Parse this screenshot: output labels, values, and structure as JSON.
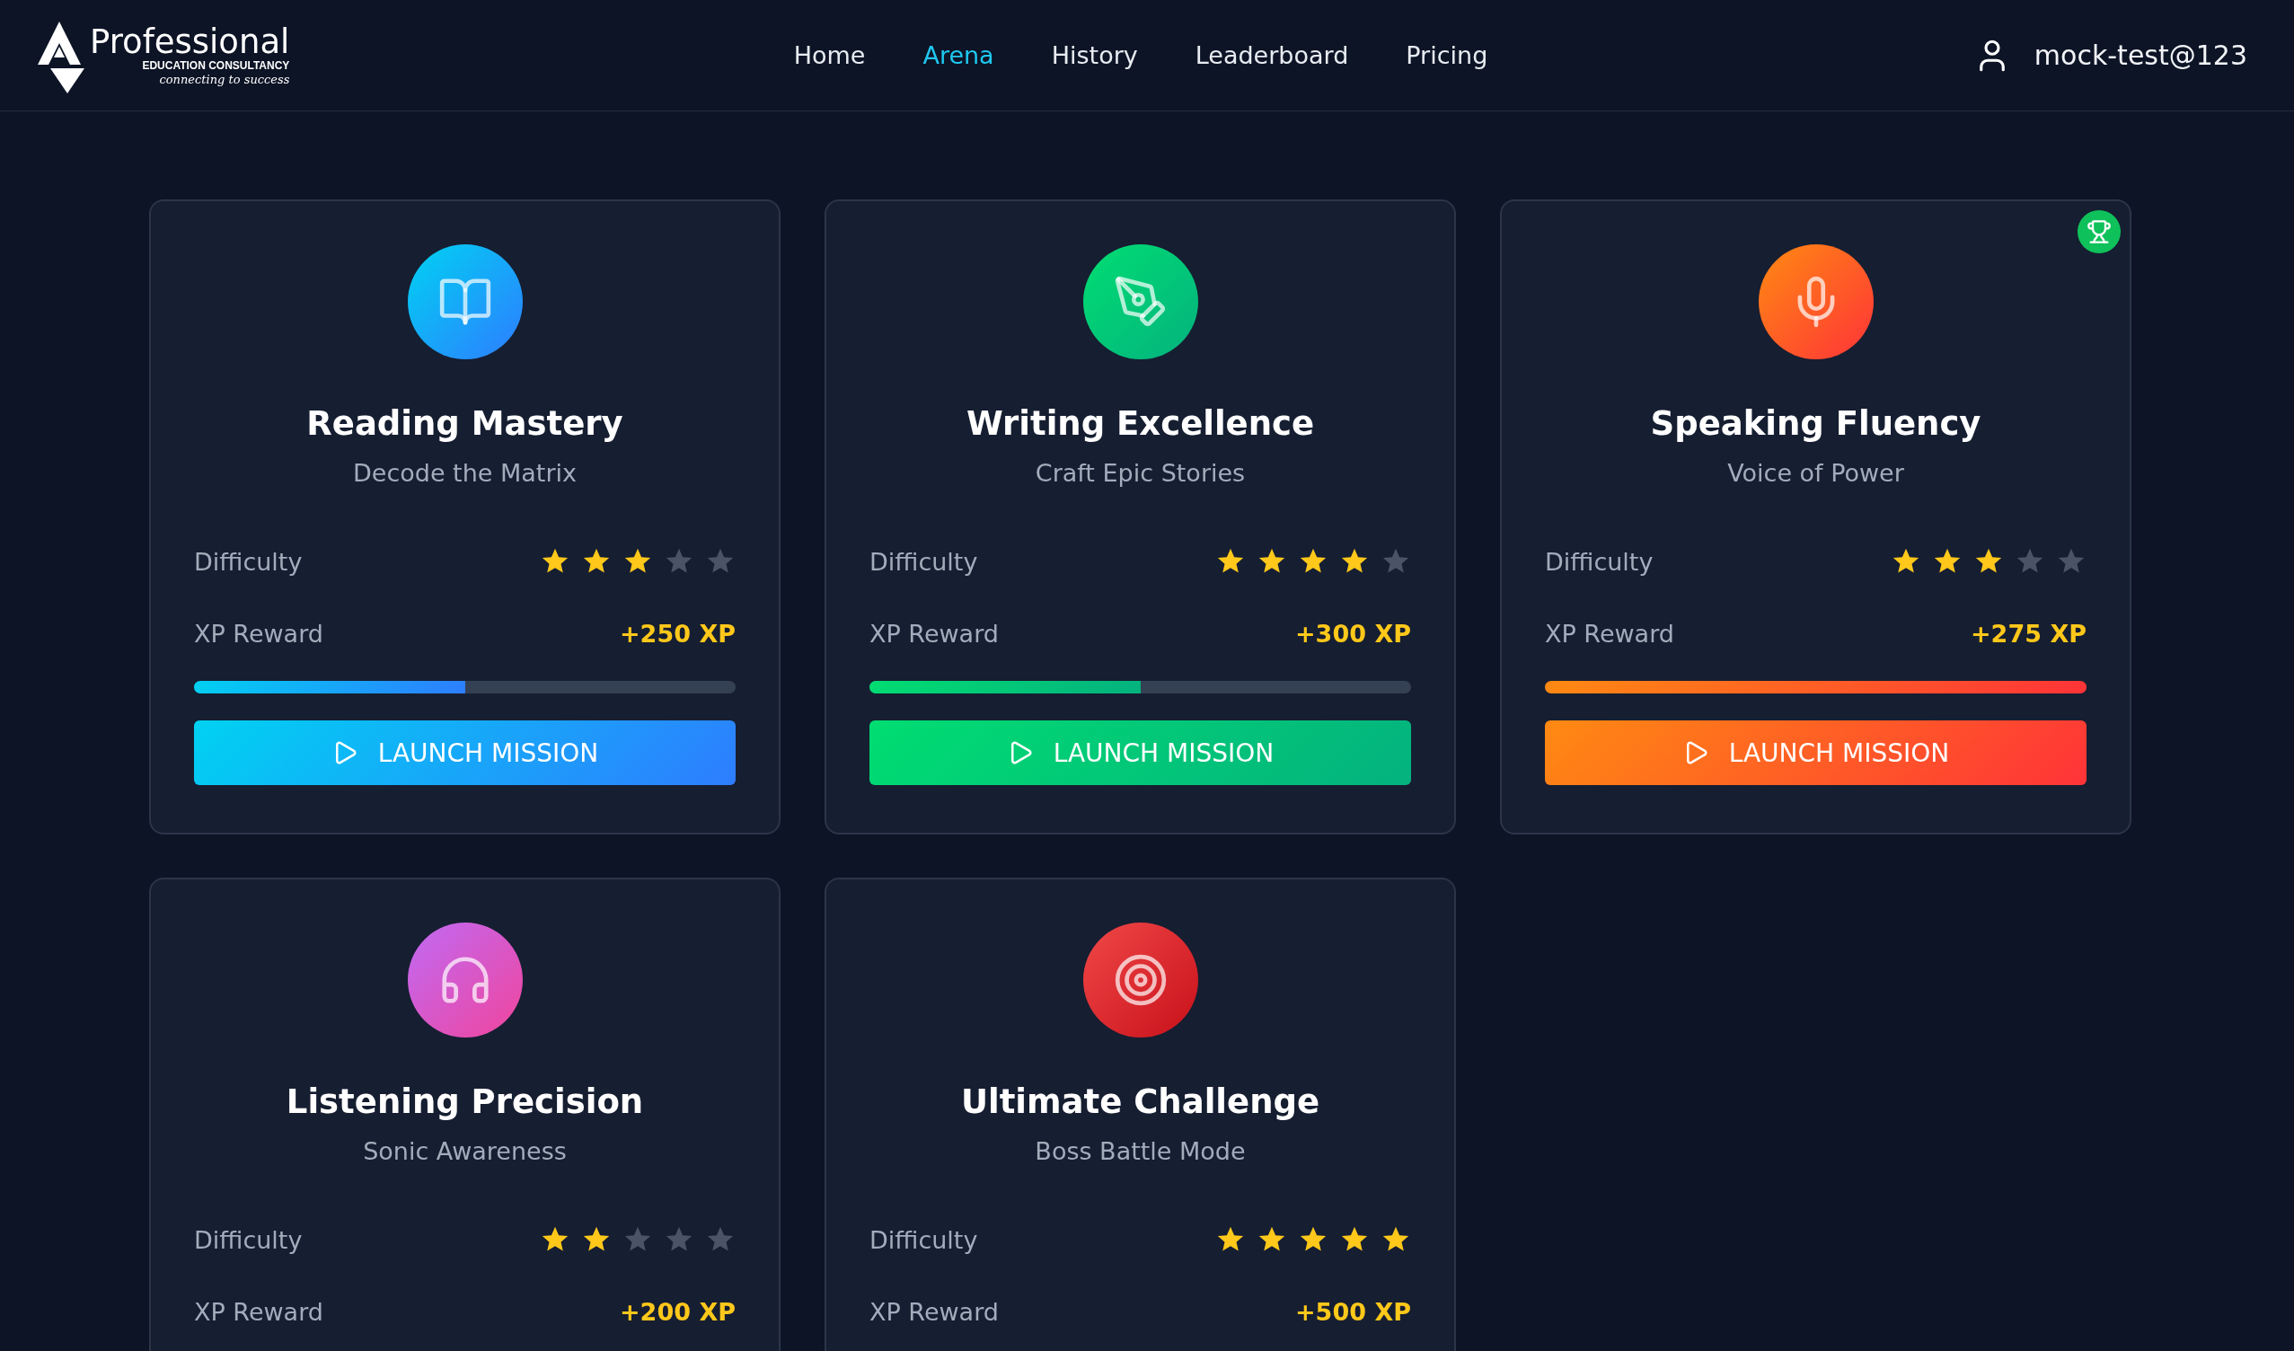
{
  "logo": {
    "name": "Professional",
    "tagline": "EDUCATION CONSULTANCY",
    "motto": "connecting to success"
  },
  "nav": [
    {
      "label": "Home",
      "selected": false
    },
    {
      "label": "Arena",
      "selected": true
    },
    {
      "label": "History",
      "selected": false
    },
    {
      "label": "Leaderboard",
      "selected": false
    },
    {
      "label": "Pricing",
      "selected": false
    }
  ],
  "user": {
    "name": "mock-test@123"
  },
  "cards": [
    {
      "kind": "reading",
      "title": "Reading Mastery",
      "subtitle": "Decode the Matrix",
      "difficulty_label": "Difficulty",
      "stars": 3,
      "xp_label": "XP Reward",
      "xp": "+250 XP",
      "level": 0.5,
      "button": "LAUNCH MISSION",
      "completed": false
    },
    {
      "kind": "writing",
      "title": "Writing Excellence",
      "subtitle": "Craft Epic Stories",
      "difficulty_label": "Difficulty",
      "stars": 4,
      "xp_label": "XP Reward",
      "xp": "+300 XP",
      "level": 0.5,
      "button": "LAUNCH MISSION",
      "completed": false
    },
    {
      "kind": "speaking",
      "title": "Speaking Fluency",
      "subtitle": "Voice of Power",
      "difficulty_label": "Difficulty",
      "stars": 3,
      "xp_label": "XP Reward",
      "xp": "+275 XP",
      "level": 1,
      "button": "LAUNCH MISSION",
      "completed": true
    },
    {
      "kind": "listening",
      "title": "Listening Precision",
      "subtitle": "Sonic Awareness",
      "difficulty_label": "Difficulty",
      "stars": 2,
      "xp_label": "XP Reward",
      "xp": "+200 XP",
      "completed": false
    },
    {
      "kind": "challenge",
      "title": "Ultimate Challenge",
      "subtitle": "Boss Battle Mode",
      "difficulty_label": "Difficulty",
      "stars": 5,
      "xp_label": "XP Reward",
      "xp": "+500 XP",
      "completed": false
    }
  ]
}
